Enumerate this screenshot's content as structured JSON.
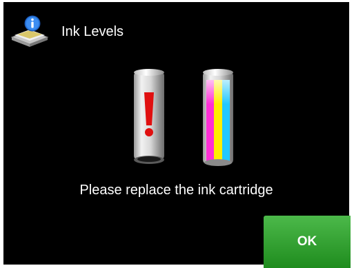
{
  "header": {
    "title": "Ink Levels",
    "icon": "info-printer-icon"
  },
  "cartridges": [
    {
      "name": "black",
      "status": "empty",
      "indicator": "exclamation-icon"
    },
    {
      "name": "color",
      "status": "ok",
      "colors": [
        "#ff00ff",
        "#ffff00",
        "#00c8ff"
      ]
    }
  ],
  "message": "Please replace the ink cartridge",
  "ok_button": {
    "label": "OK",
    "color": "#2a9d2a"
  },
  "colors": {
    "background": "#000000",
    "text": "#ffffff",
    "alert": "#e01010"
  }
}
